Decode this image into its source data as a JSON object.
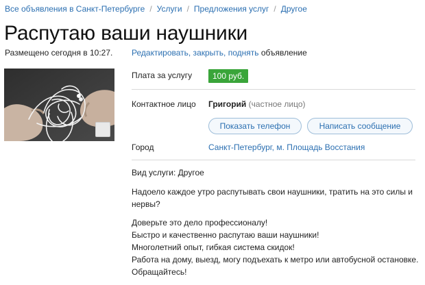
{
  "breadcrumb": {
    "items": [
      "Все объявления в Санкт-Петербурге",
      "Услуги",
      "Предложения услуг",
      "Другое"
    ],
    "separator": "/"
  },
  "listing": {
    "title": "Распутаю ваши наушники",
    "posted": "Размещено сегодня в 10:27.",
    "actions_link": "Редактировать, закрыть, поднять",
    "actions_suffix": "объявление"
  },
  "details": {
    "price_label": "Плата за услугу",
    "price_value": "100 руб.",
    "contact_label": "Контактное лицо",
    "contact_name": "Григорий",
    "contact_type": "(частное лицо)",
    "show_phone_button": "Показать телефон",
    "write_message_button": "Написать сообщение",
    "city_label": "Город",
    "city_value": "Санкт-Петербург, м. Площадь Восстания"
  },
  "description": {
    "service_type": "Вид услуги: Другое",
    "paragraph1_line1": "Надоело каждое утро распутывать свои наушники, тратить на это силы и",
    "paragraph1_line2": "нервы?",
    "lines": [
      "Доверьте это дело профессионалу!",
      "Быстро и качественно распутаю ваши наушники!",
      "Многолетний опыт, гибкая система скидок!",
      "Работа на дому, выезд, могу подъехать к метро или автобусной остановке.",
      "Обращайтесь!"
    ]
  },
  "colors": {
    "link": "#2b6fb1",
    "price_badge": "#3aa53a"
  },
  "icons": {
    "photo_badge": "gallery-icon"
  }
}
